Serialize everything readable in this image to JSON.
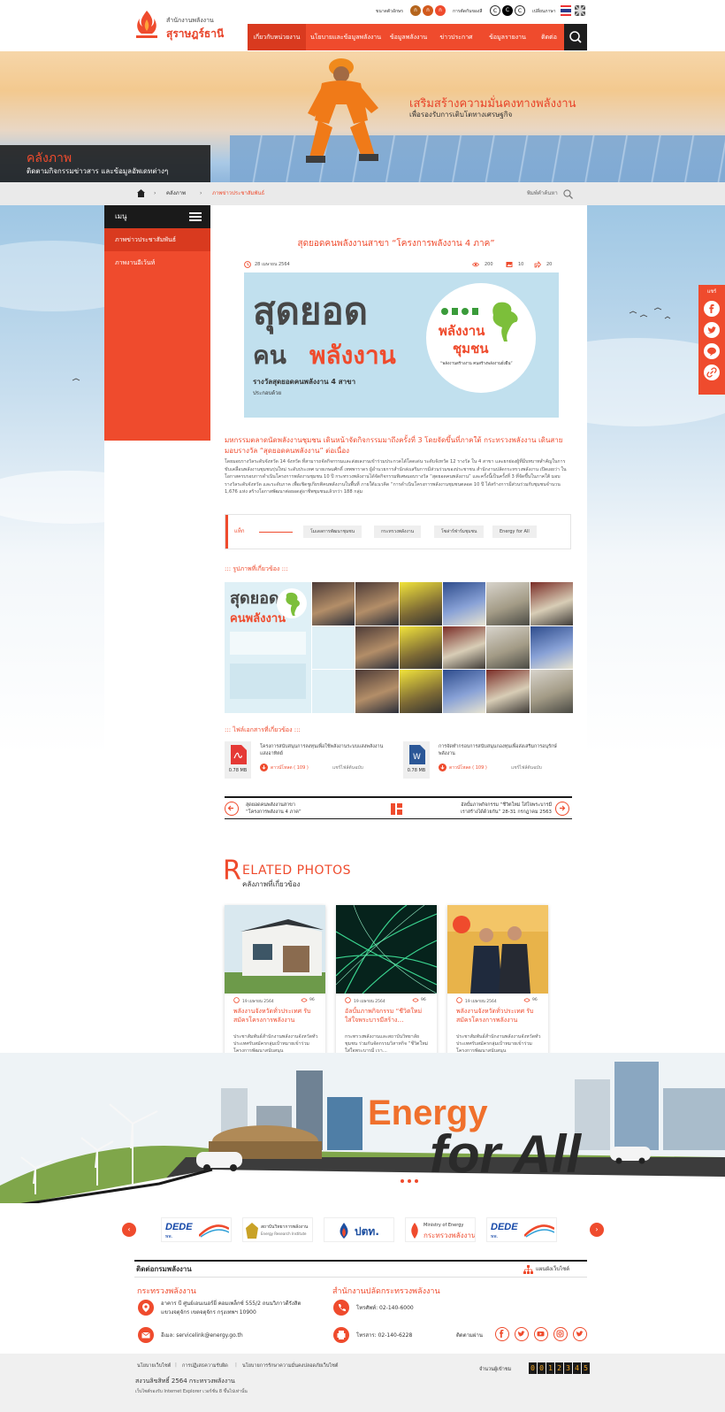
{
  "header": {
    "org_name_line1": "สำนักงานพลังงาน",
    "org_name_line2": "สุราษฎร์ธานี",
    "font_size_label": "ขนาดตัวอักษร",
    "font_sizes": [
      "ก",
      "ก",
      "ก"
    ],
    "contrast_label": "การตัดกันของสี",
    "contrast_options": [
      "C",
      "C",
      "C"
    ],
    "language_label": "เปลี่ยนภาษา"
  },
  "nav": {
    "items": [
      "เกี่ยวกับหน่วยงาน",
      "นโยบายและข้อมูลพลังงาน",
      "ข้อมูลพลังงาน",
      "ข่าวประกาศ",
      "ข้อมูลรายงาน",
      "ติดต่อ"
    ]
  },
  "hero": {
    "slogan_line1": "เสริมสร้างความมั่นคงทางพลังงาน",
    "slogan_line2": "เพื่อรองรับการเติบโตทางเศรษฐกิจ",
    "section_title": "คลังภาพ",
    "section_subtitle": "ติดตามกิจกรรมข่าวสาร และข้อมูลอัพเดทต่างๆ"
  },
  "breadcrumb": {
    "items": [
      "คลังภาพ",
      "ภาพข่าวประชาสัมพันธ์"
    ],
    "search_placeholder": "พิมพ์คำค้นหา"
  },
  "sidebar": {
    "menu_title": "เมนู",
    "items": [
      "ภาพข่าวประชาสัมพันธ์",
      "ภาพงานอีเว้นท์"
    ]
  },
  "article": {
    "title": "สุดยอดคนพลังงานสาขา “โครงการพลังงาน 4 ภาค”",
    "date": "28 เมษายน 2564",
    "views": "200",
    "images_count": "10",
    "shares": "20",
    "feature": {
      "head_line1": "สุดยอด",
      "head_line2a": "คน",
      "head_line2b": "พลังงาน",
      "sub_line1": "รางวัลสุดยอดคนพลังงาน 4 สาขา",
      "sub_line2": "ประกอบด้วย",
      "circle_line1": "พลังงาน",
      "circle_line2": "ชุมชน",
      "circle_line3": "“พลังงานสร้างงาน คนสร้างพลังงานยั่งยืน”"
    },
    "lead": "มหกรรมตลาดนัดพลังงานชุมชน เดินหน้าจัดกิจกรรมมาถึงครั้งที่ 3 โดยจัดขึ้นที่ภาคใต้ กระทรวงพลังงาน เดินสายมอบรางวัล “สุดยอดคนพลังงาน” ต่อเนื่อง",
    "body": "โดยมอบรางวัลระดับจังหวัด 14 จังหวัด ที่สามารถจัดกิจกรรมและส่งผลงานเข้าร่วมประกวดได้โดดเด่น ระดับจังหวัด 12 รางวัล ใน 4 สาขา และยกย่องผู้ที่มีบทบาทสำคัญในการขับเคลื่อนพลังงานชุมชนรุ่นใหม่ ระดับประเทศ นายเกษมศักดิ์ เทพพาราดร ผู้อำนวยการสำนักส่งเสริมการมีส่วนร่วมของประชาชน สำนักงานปลัดกระทรวงพลังงาน เปิดเผยว่า ในโอกาสครบรอบการดำเนินโครงการพลังงานชุมชน 10 ปี กระทรวงพลังงานได้จัดกิจกรรมพิเศษมอบรางวัล “สุดยอดคนพลังงาน” และครั้งนี้เป็นครั้งที่ 3 ที่จัดขึ้นในภาคใต้ มอบรางวัลระดับจังหวัด และระดับภาค เพื่อเชิดชูเกียรติคนพลังงานในพื้นที่ ภายใต้แนวคิด “การดำเนินโครงการพลังงานชุมชนตลอด 10 ปี ได้สร้างการมีส่วนร่วมกับชุมชนจำนวน 1,676 แห่ง สร้างโอกาสพัฒนาต่อยอดสู่อาชีพชุมชนแล้วกว่า 188 กลุ่ม"
  },
  "tags": {
    "label": "แท็ก",
    "items": [
      "โมเดลการพัฒนาชุมชน",
      "กระทรวงพลังงาน",
      "โซล่าร์ฟาร์มชุมชน",
      "Energy for All"
    ]
  },
  "related_images_title": "::: รูปภาพที่เกี่ยวข้อง :::",
  "photo_grid": {
    "big_line1": "สุดยอด",
    "big_line2": "คนพลังงาน"
  },
  "files": {
    "title": "::: ไฟล์เอกสารที่เกี่ยวข้อง :::",
    "items": [
      {
        "name": "โครงการสนับสนุนการลงทุนเพื่อใช้พลังงานระบบแสงพลังงานแสงอาทิตย์",
        "size": "0.78 MB",
        "download": "ดาวน์โหลด ( 109 )",
        "preview": "แชร์ไฟล์ต้นฉบับ",
        "type": "pdf"
      },
      {
        "name": "การจัดทำกรอบการสนับสนุนกองทุนเพื่อส่งเสริมการอนุรักษ์พลังงาน",
        "size": "0.78 MB",
        "download": "ดาวน์โหลด ( 109 )",
        "preview": "แชร์ไฟล์ต้นฉบับ",
        "type": "doc"
      }
    ]
  },
  "pager": {
    "prev_line1": "สุดยอดคนพลังงานสาขา",
    "prev_line2": "“โครงการพลังงาน 4 ภาค”",
    "next_line1": "อัลบั้มภาพกิจกรรม “ชีวิตใหม่ ใส่ใจพระบารมี",
    "next_line2": "เราสร้างได้ด้วยกัน” 28-31 กรกฎาคม 2563"
  },
  "related": {
    "title_initial": "R",
    "title_rest": "ELATED PHOTOS",
    "subtitle": "คลังภาพที่เกี่ยวข้อง",
    "cards": [
      {
        "date": "19 เมษายน 2564",
        "views": "96",
        "title": "พลังงานจังหวัดทั่วประเทศ รับสมัครโครงการพลังงาน",
        "desc": "ประชาสัมพันธ์สำนักงานพลังงานจังหวัดทั่วประเทศรับสมัครกลุ่มเป้าหมายเข้าร่วมโครงการพัฒนาสนับสนุน"
      },
      {
        "date": "19 เมษายน 2564",
        "views": "96",
        "title": "อัลบั้มภาพกิจกรรม “ชีวิตใหม่ ใส่ใจพระบารมีสร้าง…",
        "desc": "กระทรวงพลังงานและสถาบันวิทยาลัยชุมชน ร่วมกันจัดกรรมวิสาหกิจ “ชีวิตใหม่ใส่ใจพระบารมี เรา…"
      },
      {
        "date": "19 เมษายน 2564",
        "views": "96",
        "title": "พลังงานจังหวัดทั่วประเทศ รับสมัครโครงการพลังงาน",
        "desc": "ประชาสัมพันธ์สำนักงานพลังงานจังหวัดทั่วประเทศรับสมัครกลุ่มเป้าหมายเข้าร่วมโครงการพัฒนาสนับสนุน"
      }
    ]
  },
  "city": {
    "slogan_1": "Energy",
    "slogan_2": "for All"
  },
  "partners": [
    {
      "name": "DEDE",
      "sub": "พพ."
    },
    {
      "name": "สถาบันวิทยาการพลังงาน",
      "sub": "Energy Research Institute"
    },
    {
      "name": "ปตท.",
      "sub": "PTT"
    },
    {
      "name": "กระทรวงพลังงาน",
      "sub": "Ministry of Energy"
    },
    {
      "name": "DEDE",
      "sub": "พพ."
    }
  ],
  "contact": {
    "title": "ติดต่อกรมพลังงาน",
    "sitemap": "แผนผังเว็บไซต์",
    "org1": "กระทรวงพลังงาน",
    "org1_address_line1": "อาคาร บี ศูนย์เอนเนอร์ยี่ คอมเพล็กซ์ 555/2 ถนนวิภาวดีรังสิต",
    "org1_address_line2": "แขวงจตุจักร เขตจตุจักร กรุงเทพฯ 10900",
    "org1_email": "อีเมล: servicelink@energy.go.th",
    "org2": "สำนักงานปลัดกระทรวงพลังงาน",
    "org2_phone": "โทรศัพท์: 02-140-6000",
    "org2_fax": "โทรสาร: 02-140-6228",
    "follow_label": "ติดตามผ่าน"
  },
  "footer": {
    "links": [
      "นโยบายเว็บไซต์",
      "การปฏิเสธความรับผิด",
      "นโยบายการรักษาความมั่นคงปลอดภัยเว็บไซต์"
    ],
    "copyright": "สงวนลิขสิทธิ์ 2564 กระทรวงพลังงาน",
    "browser_note": "เว็บไซต์รองรับ Internet Explorer เวอร์ชั่น 8 ขึ้นไปเท่านั้น",
    "visitor_label": "จำนวนผู้เข้าชม",
    "visitor_digits": [
      "0",
      "0",
      "1",
      "2",
      "3",
      "4",
      "5"
    ]
  },
  "share": {
    "label": "แชร์"
  },
  "colors": {
    "accent": "#ef4b2d",
    "dark": "#1a1a1a"
  }
}
